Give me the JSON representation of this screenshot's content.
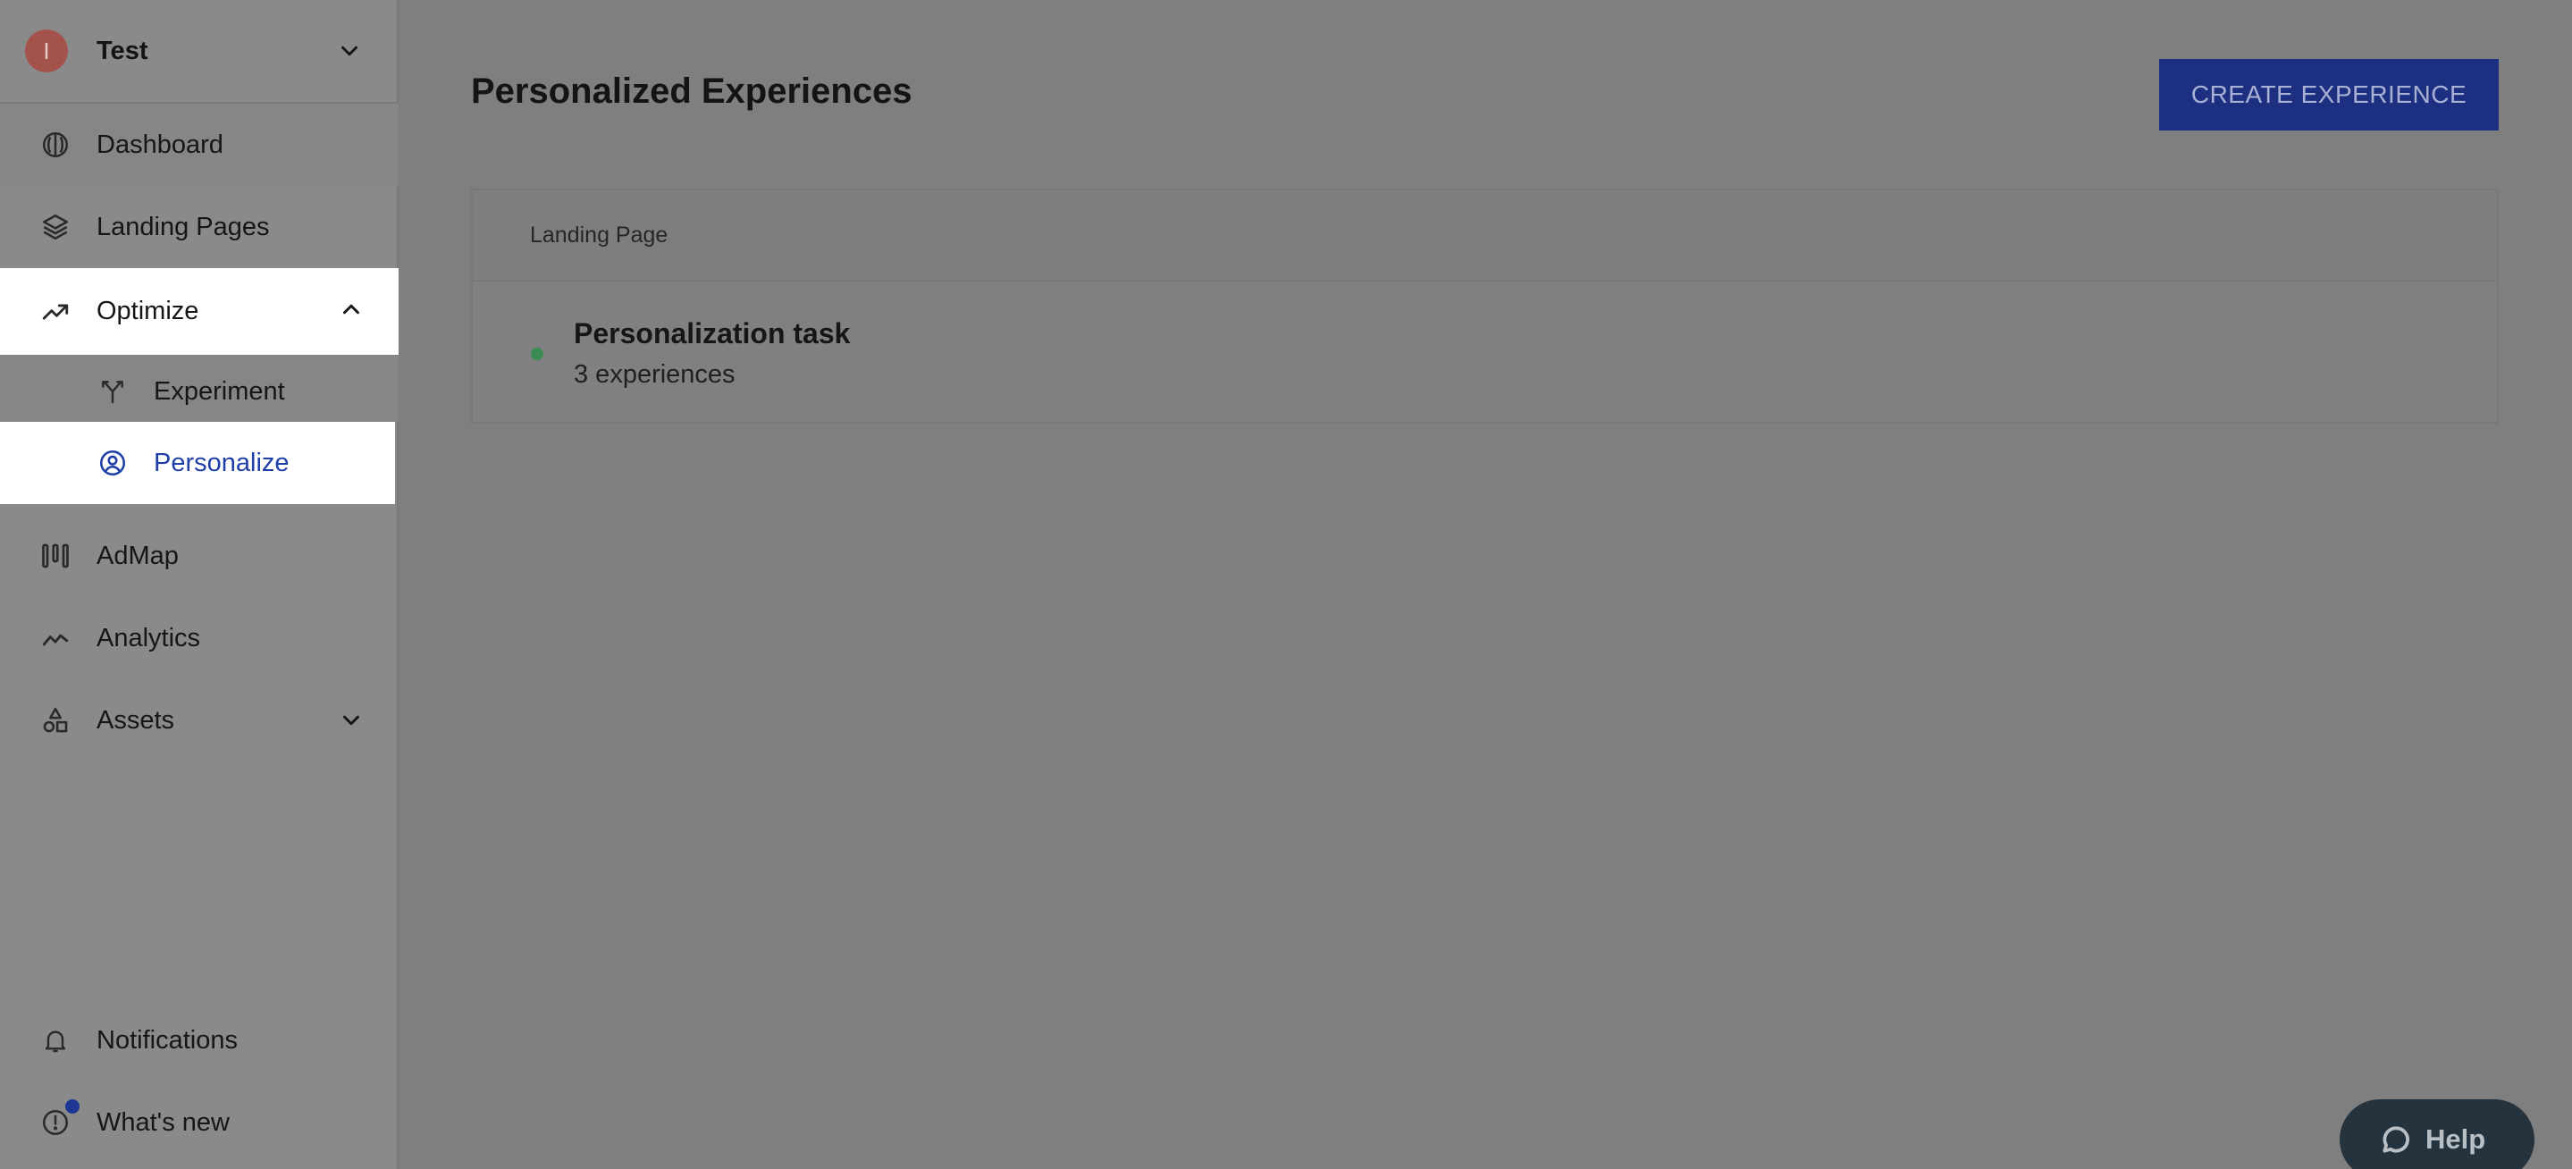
{
  "workspace": {
    "initial": "I",
    "name": "Test"
  },
  "nav": {
    "dashboard": "Dashboard",
    "landing_pages": "Landing Pages",
    "optimize": "Optimize",
    "experiment": "Experiment",
    "personalize": "Personalize",
    "admap": "AdMap",
    "analytics": "Analytics",
    "assets": "Assets",
    "notifications": "Notifications",
    "whats_new": "What's new"
  },
  "page": {
    "title": "Personalized Experiences",
    "create_label": "CREATE EXPERIENCE"
  },
  "table": {
    "header": "Landing Page",
    "rows": [
      {
        "title": "Personalization task",
        "subtitle": "3 experiences",
        "status_color": "#3a8a54"
      }
    ]
  },
  "help": {
    "label": "Help"
  },
  "colors": {
    "accent": "#1c2f80",
    "selected_text": "#1f3fa8"
  }
}
